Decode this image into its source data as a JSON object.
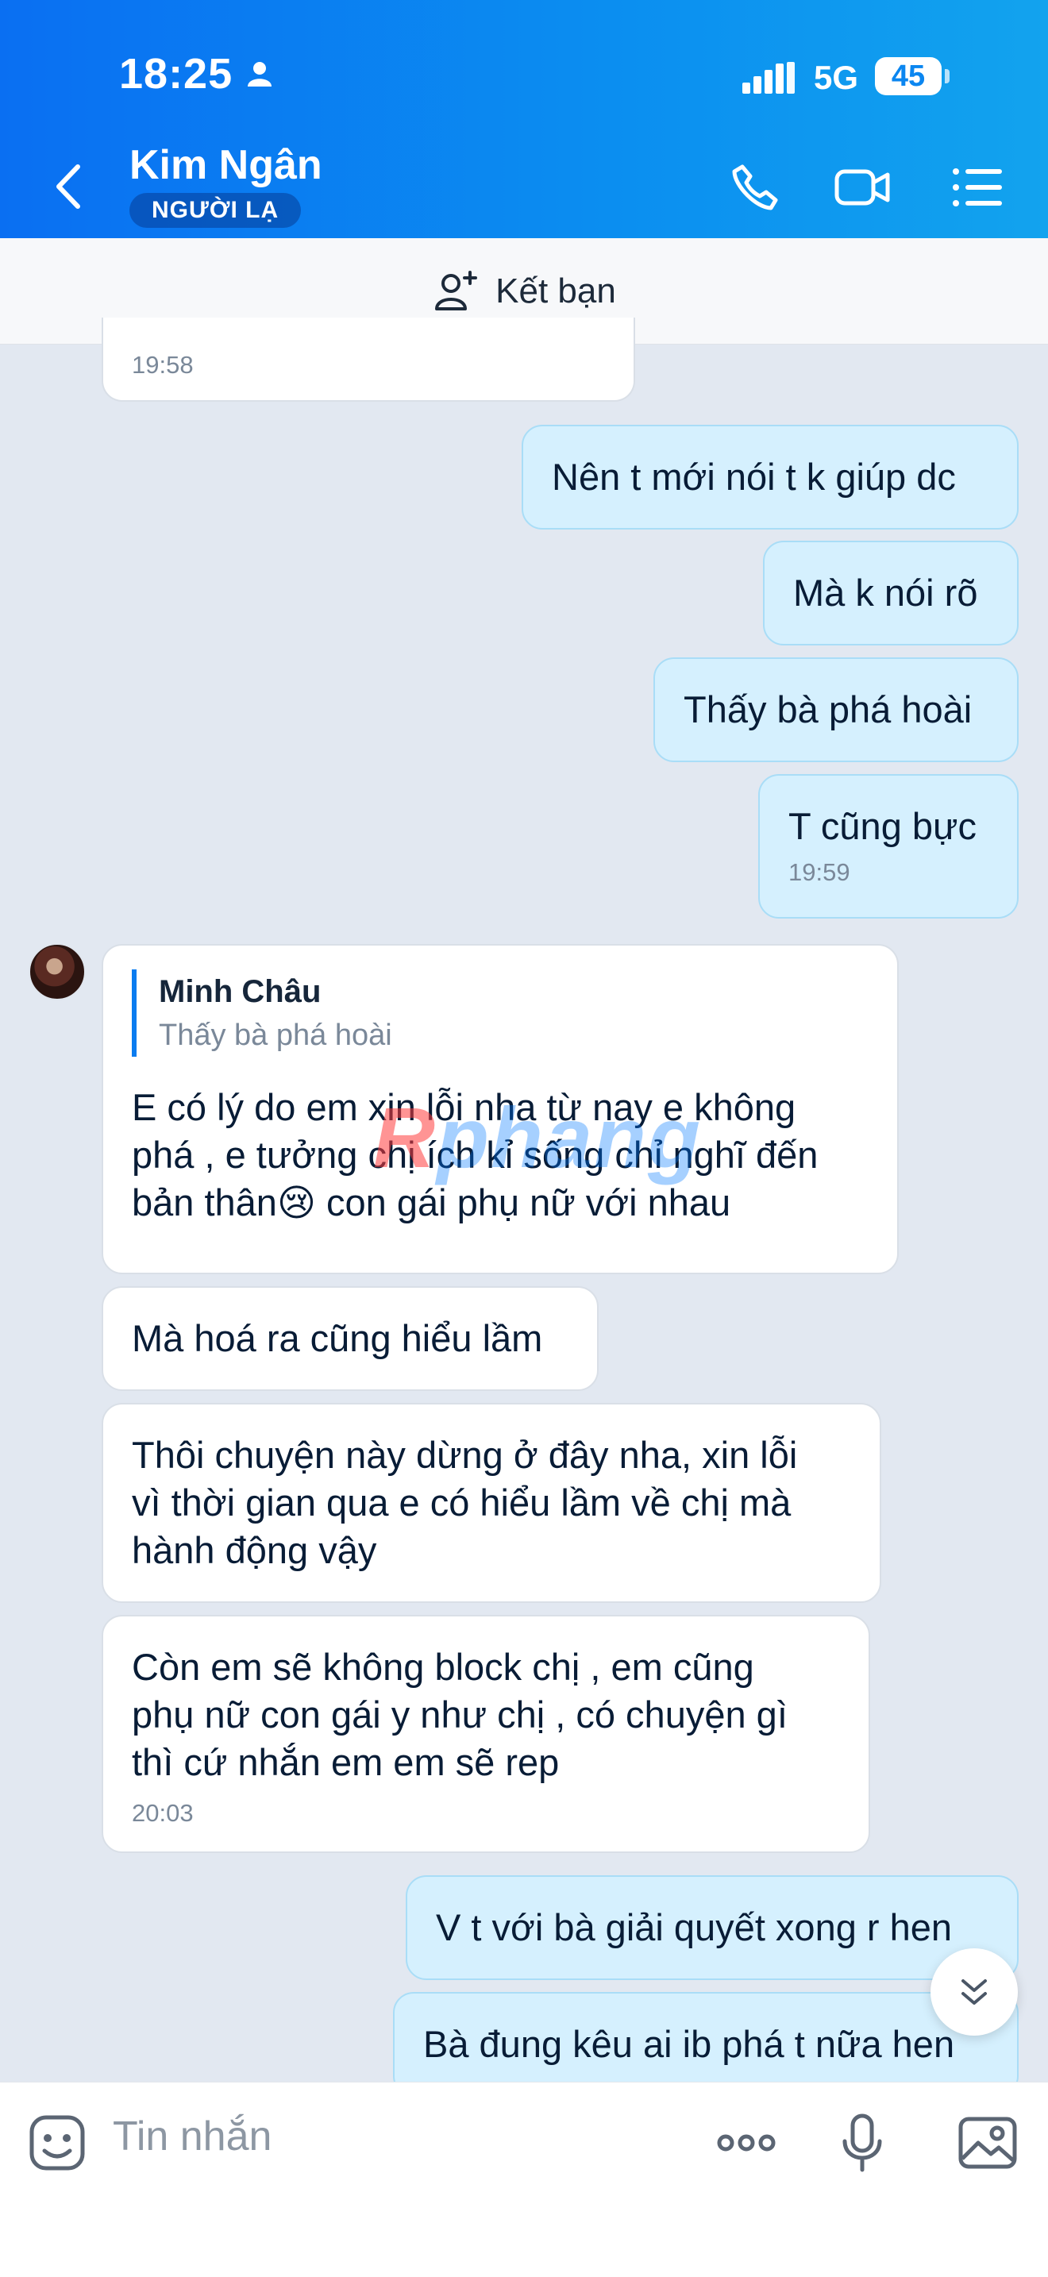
{
  "status_bar": {
    "time": "18:25",
    "network": "5G",
    "battery": "45"
  },
  "header": {
    "contact_name": "Kim Ngân",
    "badge": "NGƯỜI LẠ"
  },
  "friend_bar": {
    "label": "Kết bạn"
  },
  "messages": [
    {
      "side": "in",
      "time": "19:58"
    },
    {
      "side": "out",
      "text": "Nên t mới nói t k giúp dc"
    },
    {
      "side": "out",
      "text": "Mà k nói rõ"
    },
    {
      "side": "out",
      "text": "Thấy bà phá hoài"
    },
    {
      "side": "out",
      "text": "T cũng bực",
      "time": "19:59"
    },
    {
      "side": "in",
      "quote_name": "Minh Châu",
      "quote_text": "Thấy bà phá hoài",
      "text_lines": [
        "E có lý do em xin lỗi nha từ nay e không",
        "phá , e tưởng chị ích kỉ sống chỉ nghĩ đến",
        "bản thân😢 con gái phụ nữ với nhau"
      ]
    },
    {
      "side": "in",
      "text": "Mà hoá ra cũng hiểu lầm"
    },
    {
      "side": "in",
      "text_lines": [
        "Thôi chuyện này dừng ở đây nha, xin lỗi",
        "vì thời gian qua e có hiểu lầm về chị mà",
        "hành động vậy"
      ]
    },
    {
      "side": "in",
      "text_lines": [
        "Còn em sẽ không block chị , em cũng",
        "phụ nữ con gái y như chị , có chuyện gì",
        "thì cứ nhắn em em sẽ rep"
      ],
      "time": "20:03"
    },
    {
      "side": "out",
      "text": "V t với bà giải quyết xong r hen"
    },
    {
      "side": "out",
      "text": "Bà đung kêu ai ib phá t nữa hen"
    }
  ],
  "watermark": {
    "part1": "R",
    "part2": "phang"
  },
  "input": {
    "placeholder": "Tin nhắn"
  },
  "colors": {
    "header": "#0b86f0",
    "outgoing_bubble": "#d5f0fe",
    "incoming_bubble": "#ffffff",
    "background": "#e2e8f1"
  }
}
